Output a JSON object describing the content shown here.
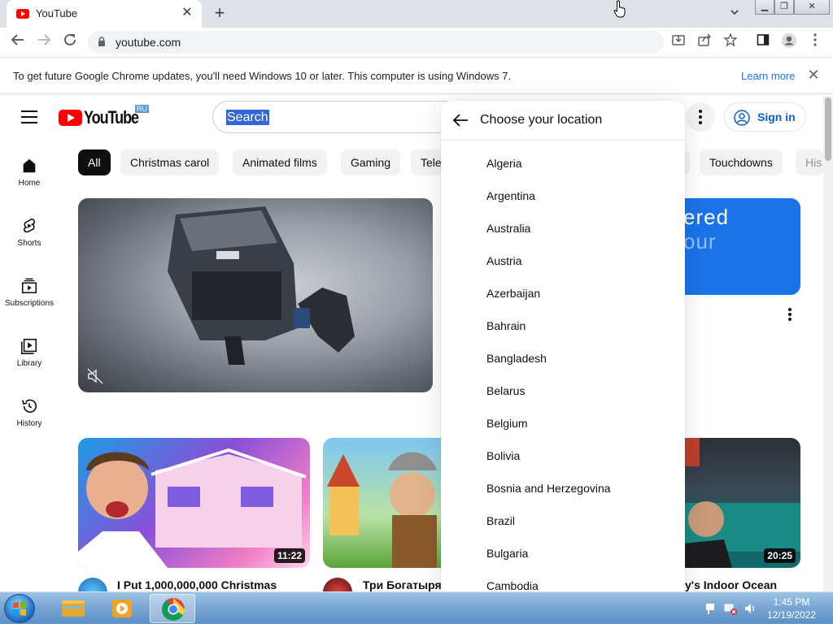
{
  "browser": {
    "tab_title": "YouTube",
    "tab_close": "✕",
    "new_tab": "+",
    "url": "youtube.com",
    "window_buttons": [
      "▁",
      "❐",
      "✕"
    ]
  },
  "infobar": {
    "message": "To get future Google Chrome updates, you'll need Windows 10 or later. This computer is using Windows 7.",
    "learn_more": "Learn more",
    "close": "✕"
  },
  "youtube": {
    "logo_text": "YouTube",
    "country_code": "RU",
    "search_text": "Search",
    "sign_in": "Sign in",
    "nav": [
      {
        "label": "Home",
        "icon": "home-icon"
      },
      {
        "label": "Shorts",
        "icon": "shorts-icon"
      },
      {
        "label": "Subscriptions",
        "icon": "subscriptions-icon"
      },
      {
        "label": "Library",
        "icon": "library-icon"
      },
      {
        "label": "History",
        "icon": "history-icon"
      }
    ],
    "chips": [
      "All",
      "Christmas carol",
      "Animated films",
      "Gaming",
      "Tele",
      "Touchdowns",
      "His"
    ],
    "banner_text_1": "ered",
    "banner_text_2": "our",
    "videos": [
      {
        "title": "I Put 1,000,000,000 Christmas",
        "duration": "11:22"
      },
      {
        "title": "Три Богатыря |",
        "duration": ""
      },
      {
        "title": "y's Indoor Ocean",
        "duration": "20:25"
      }
    ]
  },
  "location_menu": {
    "title": "Choose your location",
    "countries": [
      "Algeria",
      "Argentina",
      "Australia",
      "Austria",
      "Azerbaijan",
      "Bahrain",
      "Bangladesh",
      "Belarus",
      "Belgium",
      "Bolivia",
      "Bosnia and Herzegovina",
      "Brazil",
      "Bulgaria",
      "Cambodia"
    ]
  },
  "taskbar": {
    "time": "1:45 PM",
    "date": "12/19/2022"
  },
  "colors": {
    "youtube_red": "#ff0000",
    "link_blue": "#065fd4",
    "chrome_blue": "#1a73e8"
  }
}
